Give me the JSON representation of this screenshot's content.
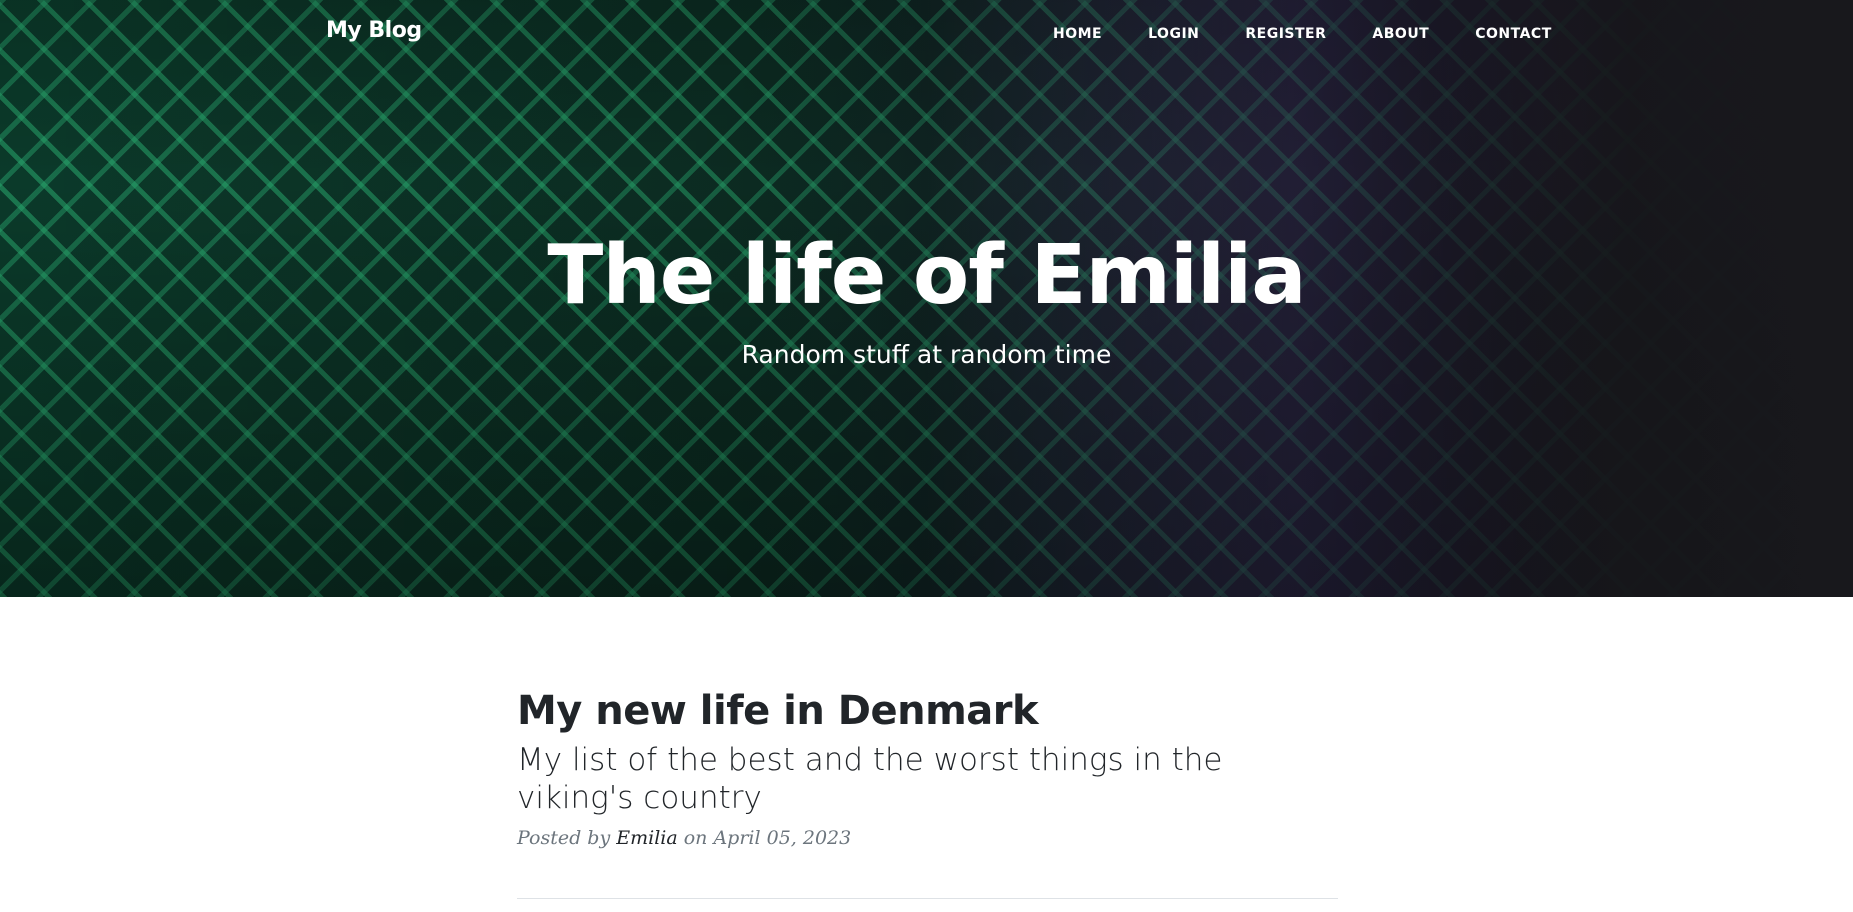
{
  "nav": {
    "brand": "My Blog",
    "links": [
      "HOME",
      "LOGIN",
      "REGISTER",
      "ABOUT",
      "CONTACT"
    ]
  },
  "hero": {
    "title": "The life of Emilia",
    "subtitle": "Random stuff at random time"
  },
  "posts": [
    {
      "title": "My new life in Denmark",
      "subtitle": "My list of the best and the worst things in the viking's country",
      "meta_prefix": "Posted by",
      "author": "Emilia",
      "meta_date": "on April 05, 2023"
    }
  ],
  "colors": {
    "text_dark": "#212529",
    "meta_gray": "#6c757d",
    "divider": "#dee2e6"
  }
}
